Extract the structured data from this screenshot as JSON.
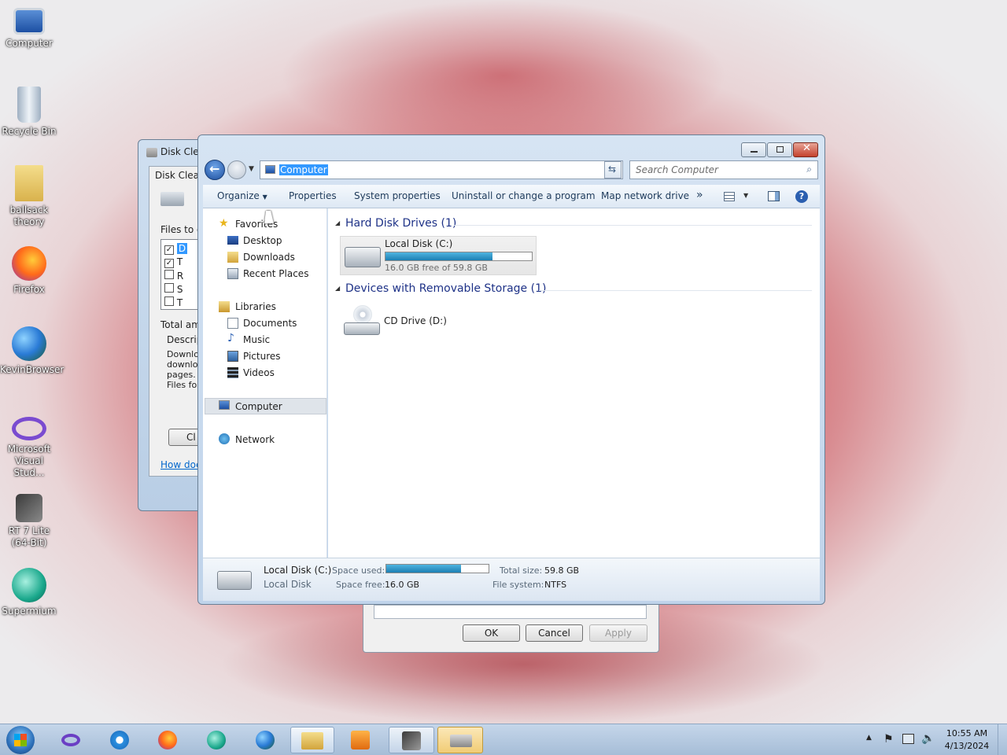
{
  "desktop": {
    "icons": [
      {
        "label": "Computer"
      },
      {
        "label": "Recycle Bin"
      },
      {
        "label": "ballsack theory"
      },
      {
        "label": "Firefox"
      },
      {
        "label": "KevinBrowser"
      },
      {
        "label": "Microsoft Visual Stud..."
      },
      {
        "label": "RT 7 Lite (64-Bit)"
      },
      {
        "label": "Supermium"
      }
    ]
  },
  "disk_cleanup": {
    "title": "Disk Clea",
    "tab": "Disk Cleanu",
    "files_label": "Files to de",
    "row_labels": [
      "D",
      "T",
      "R",
      "S",
      "T"
    ],
    "total_label": "Total amo",
    "description_label": "Descript",
    "description_lines": [
      "Downlo",
      "downlo",
      "pages.",
      "Files fol"
    ],
    "clean_button": "Cl",
    "how_link": "How does"
  },
  "properties_dialog": {
    "ok": "OK",
    "cancel": "Cancel",
    "apply": "Apply"
  },
  "explorer": {
    "address": "Computer",
    "search_placeholder": "Search Computer",
    "toolbar": {
      "organize": "Organize",
      "properties": "Properties",
      "system_properties": "System properties",
      "uninstall": "Uninstall or change a program",
      "map_drive": "Map network drive",
      "more": "»"
    },
    "nav": {
      "favorites": "Favorites",
      "desktop": "Desktop",
      "downloads": "Downloads",
      "recent": "Recent Places",
      "libraries": "Libraries",
      "documents": "Documents",
      "music": "Music",
      "pictures": "Pictures",
      "videos": "Videos",
      "computer": "Computer",
      "network": "Network"
    },
    "groups": {
      "hdd": "Hard Disk Drives (1)",
      "removable": "Devices with Removable Storage (1)"
    },
    "drive_c": {
      "name": "Local Disk (C:)",
      "free_text": "16.0 GB free of 59.8 GB",
      "used_fraction": 0.73
    },
    "drive_d": {
      "name": "CD Drive (D:)"
    },
    "status": {
      "name": "Local Disk (C:)",
      "type": "Local Disk",
      "space_used_label": "Space used:",
      "space_free_label": "Space free:",
      "space_free": "16.0 GB",
      "total_label": "Total size:",
      "total": "59.8 GB",
      "fs_label": "File system:",
      "fs": "NTFS"
    }
  },
  "taskbar": {
    "time": "10:55 AM",
    "date": "4/13/2024"
  }
}
